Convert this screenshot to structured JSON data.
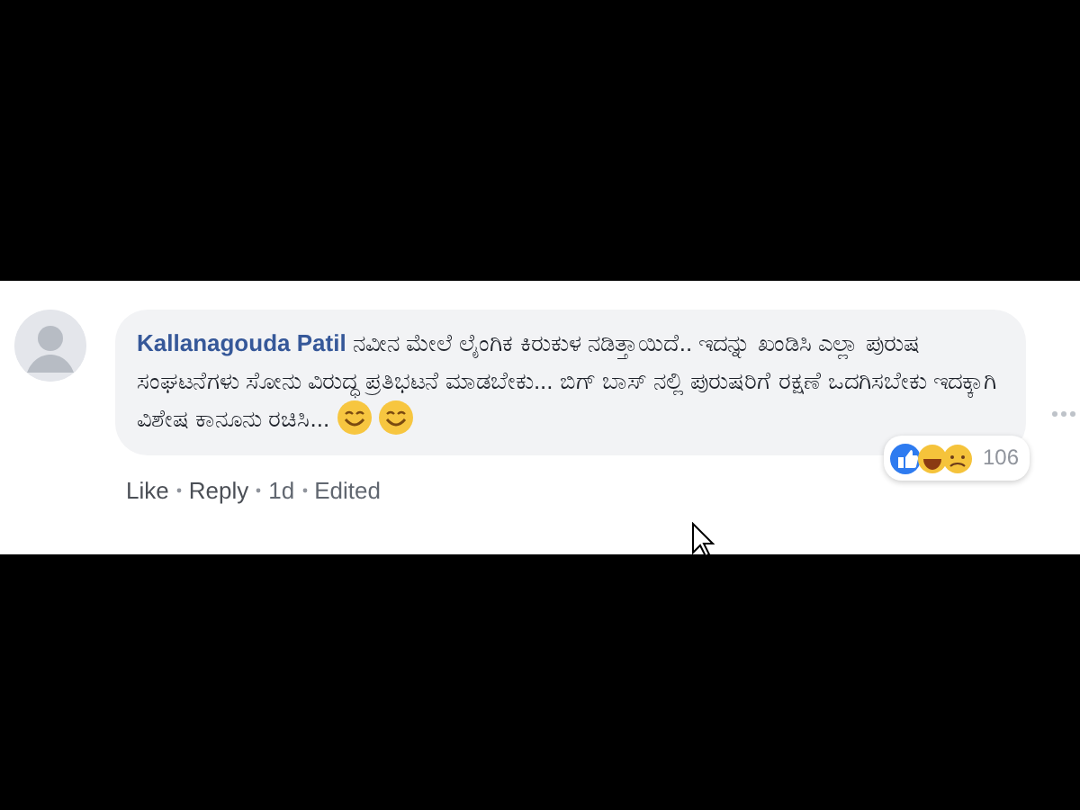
{
  "comment": {
    "author": "Kallanagouda Patil",
    "text": "ನವೀನ ಮೇಲೆ ಲೈಂಗಿಕ ಕಿರುಕುಳ ನಡಿತ್ತಾಯಿದೆ.. ಇದನ್ನು ಖಂಡಿಸಿ ಎಲ್ಲಾ ಪುರುಷ ಸಂಘಟನೆಗಳು ಸೋನು ವಿರುದ್ಧ ಪ್ರತಿಭಟನೆ ಮಾಡಬೇಕು... ಬಿಗ್ ಬಾಸ್ ನಲ್ಲಿ ಪುರುಷರಿಗೆ ರಕ್ಷಣೆ ಒದಗಿಸಬೇಕು ಇದಕ್ಕಾಗಿ ವಿಶೇಷ ಕಾನೂನು ರಚಿಸಿ...",
    "actions": [
      {
        "label": "Like"
      },
      {
        "label": "Reply"
      },
      {
        "label": "1d"
      },
      {
        "label": "Edited"
      }
    ],
    "reaction_count": "106"
  }
}
